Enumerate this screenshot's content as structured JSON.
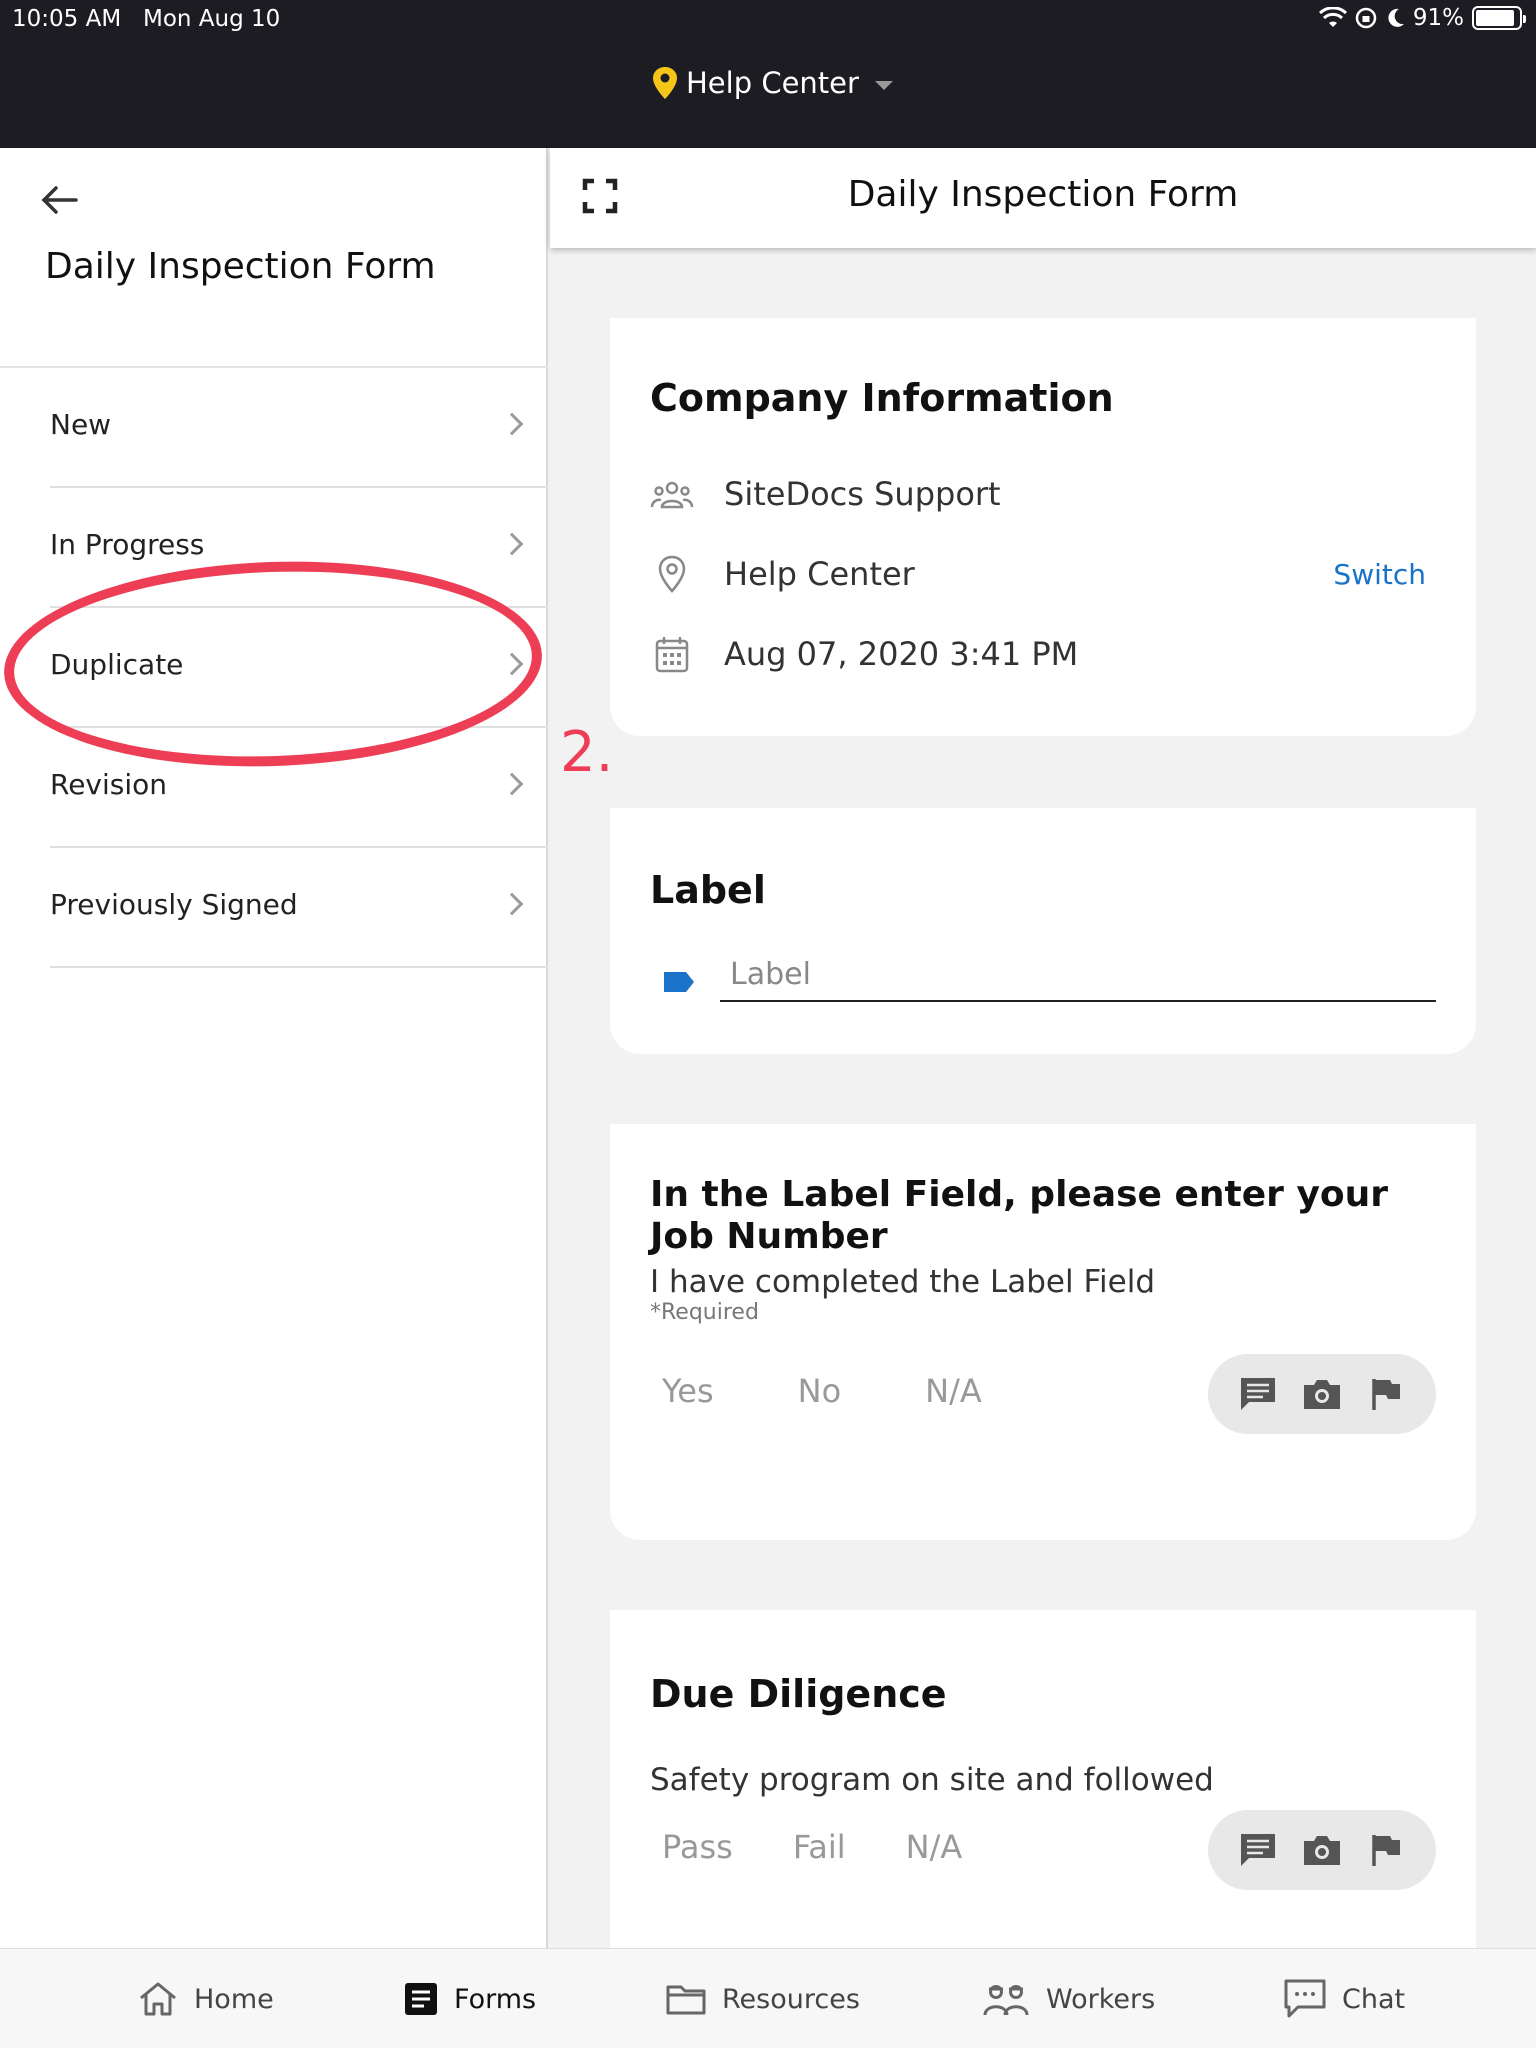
{
  "status_bar": {
    "time": "10:05 AM",
    "date": "Mon Aug 10",
    "battery": "91%",
    "battery_level": 0.91
  },
  "location": {
    "label": "Help Center"
  },
  "left_panel": {
    "title": "Daily Inspection Form",
    "menu": [
      {
        "label": "New"
      },
      {
        "label": "In Progress"
      },
      {
        "label": "Duplicate"
      },
      {
        "label": "Revision"
      },
      {
        "label": "Previously Signed"
      }
    ]
  },
  "right_header": {
    "title": "Daily Inspection Form"
  },
  "company_card": {
    "heading": "Company Information",
    "company": "SiteDocs Support",
    "location": "Help Center",
    "switch_label": "Switch",
    "date": "Aug 07, 2020 3:41 PM"
  },
  "label_card": {
    "heading": "Label",
    "placeholder": "Label"
  },
  "question_card": {
    "question": "In the Label Field, please enter your Job Number",
    "sub": "I have completed the Label Field",
    "required": "*Required",
    "options": [
      "Yes",
      "No",
      "N/A"
    ]
  },
  "diligence_card": {
    "heading": "Due Diligence",
    "sub": "Safety program on site and followed",
    "options": [
      "Pass",
      "Fail",
      "N/A"
    ]
  },
  "annotation": {
    "number": "2."
  },
  "bottom_nav": [
    {
      "label": "Home",
      "icon": "home-icon"
    },
    {
      "label": "Forms",
      "icon": "forms-icon"
    },
    {
      "label": "Resources",
      "icon": "folder-icon"
    },
    {
      "label": "Workers",
      "icon": "workers-icon"
    },
    {
      "label": "Chat",
      "icon": "chat-icon"
    }
  ],
  "colors": {
    "accent": "#1a73c9",
    "annotation": "#ee3e55",
    "topbar": "#1c1c22",
    "pin": "#f5c518",
    "tag": "#1a73c9"
  }
}
